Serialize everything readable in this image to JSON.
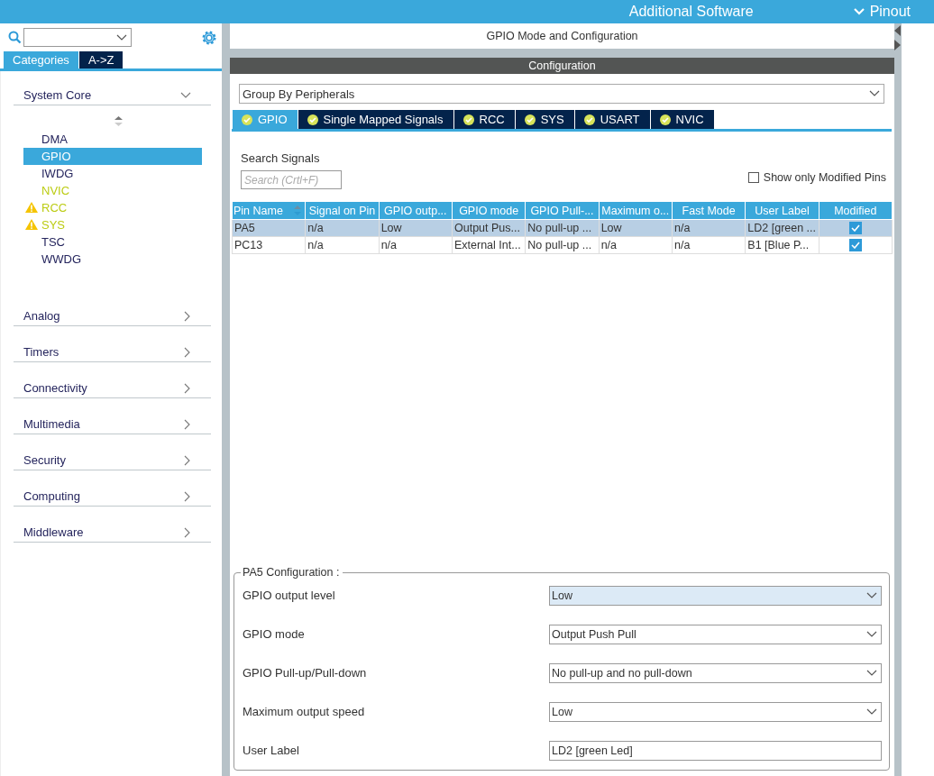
{
  "top_bar": {
    "items": [
      {
        "label": "Additional Software",
        "kind": "text"
      },
      {
        "label": "Pinout",
        "kind": "dropdown"
      }
    ]
  },
  "sidebar": {
    "tabs": [
      {
        "label": "Categories",
        "selected": true
      },
      {
        "label": "A->Z",
        "selected": false
      }
    ],
    "categories": [
      {
        "label": "System Core",
        "expanded": true,
        "children": [
          {
            "label": "DMA",
            "configured": false,
            "warning": false,
            "selected": false
          },
          {
            "label": "GPIO",
            "configured": false,
            "warning": false,
            "selected": true
          },
          {
            "label": "IWDG",
            "configured": false,
            "warning": false,
            "selected": false
          },
          {
            "label": "NVIC",
            "configured": true,
            "warning": false,
            "selected": false
          },
          {
            "label": "RCC",
            "configured": true,
            "warning": true,
            "selected": false
          },
          {
            "label": "SYS",
            "configured": true,
            "warning": true,
            "selected": false
          },
          {
            "label": "TSC",
            "configured": false,
            "warning": false,
            "selected": false
          },
          {
            "label": "WWDG",
            "configured": false,
            "warning": false,
            "selected": false
          }
        ]
      },
      {
        "label": "Analog",
        "expanded": false
      },
      {
        "label": "Timers",
        "expanded": false
      },
      {
        "label": "Connectivity",
        "expanded": false
      },
      {
        "label": "Multimedia",
        "expanded": false
      },
      {
        "label": "Security",
        "expanded": false
      },
      {
        "label": "Computing",
        "expanded": false
      },
      {
        "label": "Middleware",
        "expanded": false
      }
    ]
  },
  "main": {
    "title": "GPIO Mode and Configuration",
    "section": "Configuration",
    "group_by": "Group By Peripherals",
    "tabs": [
      {
        "label": "GPIO",
        "selected": true
      },
      {
        "label": "Single Mapped Signals",
        "selected": false
      },
      {
        "label": "RCC",
        "selected": false
      },
      {
        "label": "SYS",
        "selected": false
      },
      {
        "label": "USART",
        "selected": false
      },
      {
        "label": "NVIC",
        "selected": false
      }
    ],
    "search_label": "Search Signals",
    "search": {
      "placeholder": "Search (Crtl+F)"
    },
    "show_modified": {
      "label": "Show only Modified Pins",
      "checked": false
    },
    "table": {
      "columns": [
        "Pin Name",
        "Signal on Pin",
        "GPIO outp...",
        "GPIO mode",
        "GPIO Pull-...",
        "Maximum o...",
        "Fast Mode",
        "User Label",
        "Modified"
      ],
      "rows": [
        {
          "selected": true,
          "cells": [
            "PA5",
            "n/a",
            "Low",
            "Output Pus...",
            "No pull-up ...",
            "Low",
            "n/a",
            "LD2 [green ..."
          ],
          "modified": true
        },
        {
          "selected": false,
          "cells": [
            "PC13",
            "n/a",
            "n/a",
            "External Int...",
            "No pull-up ...",
            "n/a",
            "n/a",
            "B1 [Blue P..."
          ],
          "modified": true
        }
      ]
    },
    "config": {
      "title": "PA5 Configuration :",
      "rows": [
        {
          "label": "GPIO output level",
          "value": "Low",
          "kind": "select",
          "focused": true
        },
        {
          "label": "GPIO mode",
          "value": "Output Push Pull",
          "kind": "select",
          "focused": false
        },
        {
          "label": "GPIO Pull-up/Pull-down",
          "value": "No pull-up and no pull-down",
          "kind": "select",
          "focused": false
        },
        {
          "label": "Maximum output speed",
          "value": "Low",
          "kind": "select",
          "focused": false
        },
        {
          "label": "User Label",
          "value": "LD2 [green Led]",
          "kind": "text",
          "focused": false
        }
      ]
    }
  }
}
